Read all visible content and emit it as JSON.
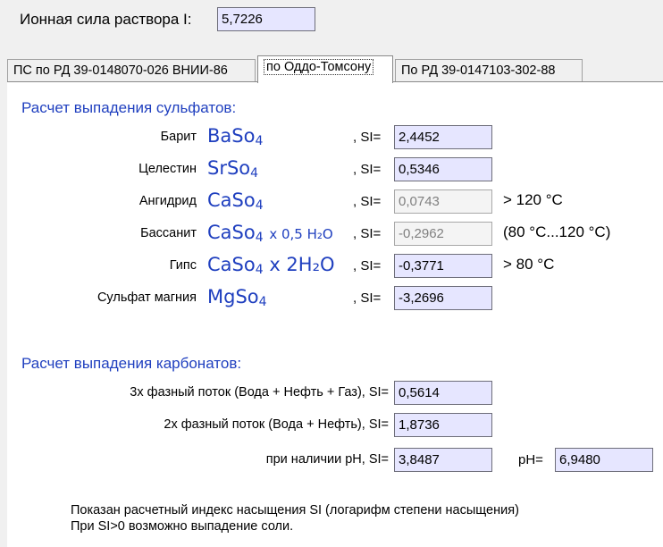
{
  "ionic_strength": {
    "label": "Ионная сила раствора I:",
    "value": "5,7226"
  },
  "tabs": [
    {
      "label": "ПС по РД 39-0148070-026 ВНИИ-86",
      "active": false
    },
    {
      "label": "по Оддо-Томсону",
      "active": true
    },
    {
      "label": "По РД 39-0147103-302-88",
      "active": false
    }
  ],
  "sulfates": {
    "title": "Расчет выпадения сульфатов:",
    "si_label": ", SI=",
    "rows": [
      {
        "name": "Барит",
        "formula": "BaSo",
        "sub": "4",
        "suffix": "",
        "si": "2,4452",
        "enabled": true,
        "condition": ""
      },
      {
        "name": "Целестин",
        "formula": "SrSo",
        "sub": "4",
        "suffix": "",
        "si": "0,5346",
        "enabled": true,
        "condition": ""
      },
      {
        "name": "Ангидрид",
        "formula": "CaSo",
        "sub": "4",
        "suffix": "",
        "si": "0,0743",
        "enabled": false,
        "condition": "> 120 °C"
      },
      {
        "name": "Бассанит",
        "formula": "CaSo",
        "sub": "4",
        "suffix": "x 0,5 H₂O",
        "si": "-0,2962",
        "enabled": false,
        "condition": "(80 °C...120 °C)"
      },
      {
        "name": "Гипс",
        "formula": "CaSo",
        "sub": "4",
        "suffix": "x 2H₂O",
        "si": "-0,3771",
        "enabled": true,
        "condition": "> 80 °C"
      },
      {
        "name": "Сульфат магния",
        "formula": "MgSo",
        "sub": "4",
        "suffix": "",
        "si": "-3,2696",
        "enabled": true,
        "condition": ""
      }
    ]
  },
  "carbonates": {
    "title": "Расчет выпадения карбонатов:",
    "rows": [
      {
        "label": "3х фазный  поток  (Вода + Нефть + Газ), SI=",
        "si": "0,5614"
      },
      {
        "label": "2х фазный  поток (Вода + Нефть), SI=",
        "si": "1,8736"
      },
      {
        "label": "при наличии pH, SI=",
        "si": "3,8487"
      }
    ],
    "ph_label": "pH=",
    "ph_value": "6,9480"
  },
  "note": {
    "line1": "Показан расчетный индекс насыщения SI (логарифм степени насыщения)",
    "line2": "При SI>0 возможно выпадение соли."
  },
  "colors": {
    "accent_blue": "#1f3fbf",
    "field_bg": "#e6e6ff"
  }
}
